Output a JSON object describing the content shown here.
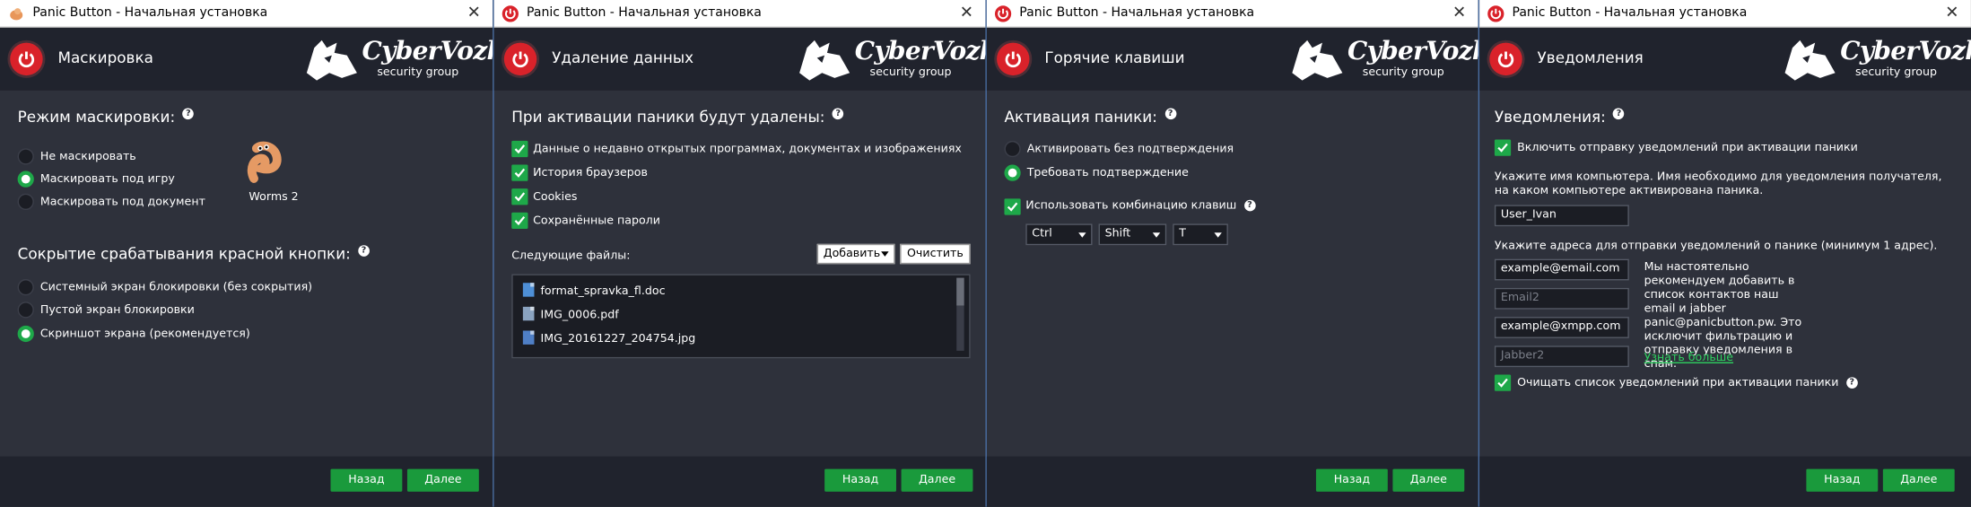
{
  "window_title": "Panic Button - Начальная установка",
  "brand": {
    "name": "CyberVozh",
    "sub": "security group"
  },
  "footer": {
    "back": "Назад",
    "next": "Далее"
  },
  "windows": [
    {
      "page_title": "Маскировка",
      "disguise_heading": "Режим маскировки:",
      "disguise_options": [
        "Не маскировать",
        "Маскировать под игру",
        "Маскировать под документ"
      ],
      "disguise_selected": 1,
      "game_label": "Worms 2",
      "hide_heading": "Сокрытие срабатывания красной кнопки:",
      "hide_options": [
        "Системный экран блокировки (без сокрытия)",
        "Пустой экран блокировки",
        "Скриншот экрана (рекомендуется)"
      ],
      "hide_selected": 2
    },
    {
      "page_title": "Удаление данных",
      "heading": "При активации паники будут удалены:",
      "checks": [
        "Данные о недавно открытых программах, документах и изображениях",
        "История браузеров",
        "Cookies",
        "Сохранённые пароли"
      ],
      "files_label": "Следующие файлы:",
      "add_button": "Добавить",
      "clear_button": "Очистить",
      "files": [
        "format_spravka_fl.doc",
        "IMG_0006.pdf",
        "IMG_20161227_204754.jpg"
      ]
    },
    {
      "page_title": "Горячие клавиши",
      "heading": "Активация паники:",
      "options": [
        "Активировать без подтверждения",
        "Требовать подтверждение"
      ],
      "selected": 1,
      "combo_label": "Использовать комбинацию клавиш",
      "keys": [
        "Ctrl",
        "Shift",
        "T"
      ]
    },
    {
      "page_title": "Уведомления",
      "heading": "Уведомления:",
      "enable_label": "Включить отправку уведомлений при активации паники",
      "computer_hint": "Укажите имя компьютера. Имя необходимо для уведомления получателя, на каком компьютере активирована паника.",
      "computer_name": "User_Ivan",
      "address_hint": "Укажите адреса для отправки уведомлений о панике (минимум 1 адрес).",
      "email1": "example@email.com",
      "email2_placeholder": "Email2",
      "jabber1": "example@xmpp.com",
      "jabber2_placeholder": "Jabber2",
      "recommend_text": "Мы настоятельно рекомендуем добавить в список контактов наш email и jabber panic@panicbutton.pw. Это исключит фильтрацию и отправку уведомления в спам.",
      "learn_more": "Узнать больше",
      "clear_label": "Очищать список уведомлений при активации паники"
    }
  ]
}
